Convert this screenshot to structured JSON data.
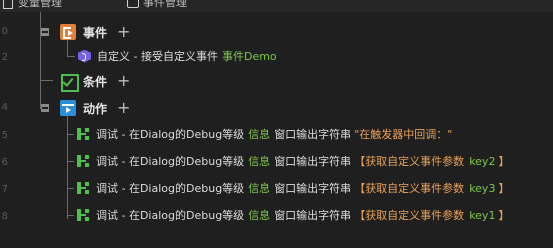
{
  "tabs": [
    {
      "label": "变量管理",
      "icon": "brackets-icon"
    },
    {
      "label": "事件管理",
      "icon": "event-tab-icon"
    }
  ],
  "line_numbers": [
    "0",
    "2",
    "",
    "4",
    "5",
    "6",
    "7",
    "8"
  ],
  "sections": {
    "event": {
      "label": "事件",
      "icon": "event-icon",
      "plus": "+"
    },
    "condition": {
      "label": "条件",
      "icon": "condition-icon",
      "plus": "+"
    },
    "action": {
      "label": "动作",
      "icon": "action-icon",
      "plus": "+"
    }
  },
  "event_item": {
    "text": "自定义 - 接受自定义事件",
    "value": "事件Demo"
  },
  "actions": [
    {
      "prefix": "调试 - 在Dialog的Debug等级",
      "level": "信息",
      "mid": "窗口输出字符串",
      "open": "\"",
      "label": "在触发器中回调：",
      "key": "",
      "close": "\""
    },
    {
      "prefix": "调试 - 在Dialog的Debug等级",
      "level": "信息",
      "mid": "窗口输出字符串",
      "open": "【",
      "label": "获取自定义事件参数",
      "key": "key2",
      "close": "】"
    },
    {
      "prefix": "调试 - 在Dialog的Debug等级",
      "level": "信息",
      "mid": "窗口输出字符串",
      "open": "【",
      "label": "获取自定义事件参数",
      "key": "key3",
      "close": "】"
    },
    {
      "prefix": "调试 - 在Dialog的Debug等级",
      "level": "信息",
      "mid": "窗口输出字符串",
      "open": "【",
      "label": "获取自定义事件参数",
      "key": "key1",
      "close": "】"
    }
  ],
  "colors": {
    "background": "#1f1f1f",
    "keyword_green": "#7ec64d",
    "string_orange": "#e8a15a",
    "event_icon": "#e0803a",
    "action_icon": "#2c8fd6",
    "custom_icon": "#7560e8"
  }
}
